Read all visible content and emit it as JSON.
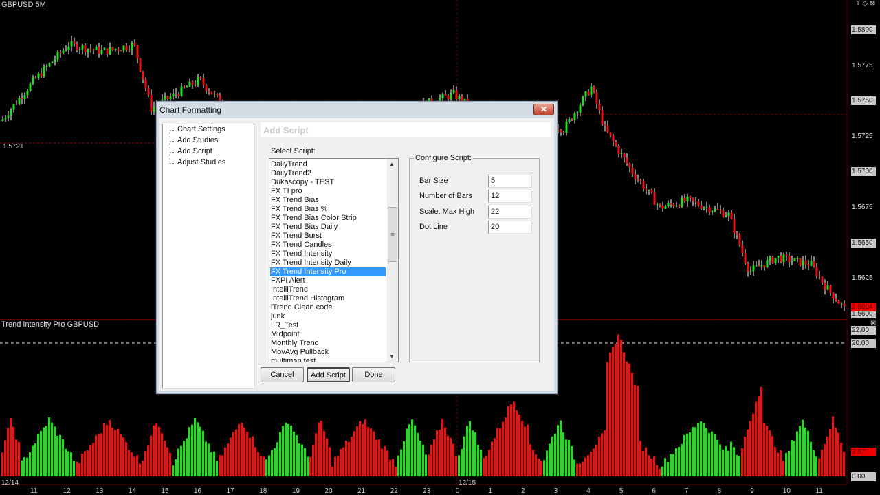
{
  "chart": {
    "symbol_title": "GBPUSD 5M",
    "study_title": "Trend Intensity Pro GBPUSD",
    "crosshair_price": "1.5721",
    "price_axis": [
      "1.5800",
      "1.5775",
      "1.5750",
      "1.5725",
      "1.5700",
      "1.5675",
      "1.5650",
      "1.5625",
      "1.5600"
    ],
    "last_price": "1.5604",
    "study_axis": {
      "max": "22.00",
      "dot_line": "20.00",
      "current": "3.57",
      "zero": "0.00"
    },
    "dates": [
      "12/14",
      "12/15"
    ],
    "hours": [
      "11",
      "12",
      "13",
      "14",
      "15",
      "16",
      "17",
      "18",
      "19",
      "20",
      "21",
      "22",
      "23",
      "0",
      "1",
      "2",
      "3",
      "4",
      "5",
      "6",
      "7",
      "8",
      "9",
      "10",
      "11"
    ],
    "colors": {
      "up": "#22dd22",
      "down": "#ee1111",
      "grid": "#5a0000"
    },
    "window_icons": [
      "pin-icon",
      "restore-icon",
      "close-icon"
    ]
  },
  "dialog": {
    "title": "Chart Formatting",
    "close_label": "✕",
    "tree": [
      "Chart Settings",
      "Add Studies",
      "Add Script",
      "Adjust Studies"
    ],
    "header": "Add Script",
    "select_label": "Select Script:",
    "scripts": [
      "DailyTrend",
      "DailyTrend2",
      "Dukascopy - TEST",
      "FX TI pro",
      "FX Trend Bias",
      "FX Trend Bias %",
      "FX Trend Bias Color Strip",
      "FX Trend Bias Daily",
      "FX Trend Burst",
      "FX Trend Candles",
      "FX Trend Intensity",
      "FX Trend Intensity Daily",
      "FX Trend Intensity Pro",
      "FXPI Alert",
      "IntelliTrend",
      "IntelliTrend Histogram",
      "iTrend Clean code",
      "junk",
      "LR_Test",
      "Midpoint",
      "Monthly Trend",
      "MovAvg Pullback",
      "multiman test"
    ],
    "selected_script": "FX Trend Intensity Pro",
    "configure_label": "Configure Script:",
    "params": [
      {
        "label": "Bar Size",
        "value": "5"
      },
      {
        "label": "Number of Bars",
        "value": "12"
      },
      {
        "label": "Scale: Max High",
        "value": "22"
      },
      {
        "label": "Dot Line",
        "value": "20"
      }
    ],
    "buttons": {
      "cancel": "Cancel",
      "add": "Add Script",
      "done": "Done"
    }
  }
}
